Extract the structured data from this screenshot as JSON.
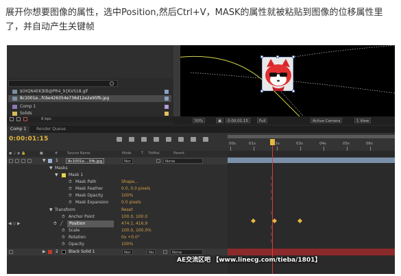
{
  "caption": "展开你想要图像的属性，选中Position,然后Ctrl+V，MASK的属性就被粘贴到图像的位移属性里了，并自动产生关键帧",
  "project": {
    "items": [
      {
        "name": "$(HQN4EK]KB@PR4_9{KVS18.gif",
        "type": "image",
        "selected": false
      },
      {
        "name": "8c1001e...fcbe426354e736d12e2e95fb.jpg",
        "type": "image",
        "selected": true
      },
      {
        "name": "Comp 1",
        "type": "comp",
        "selected": false
      },
      {
        "name": "Solids",
        "type": "folder",
        "selected": false
      }
    ],
    "bpc": "8 bpc"
  },
  "viewer": {
    "zoom": "50%",
    "timecode": "0:00:01:15",
    "resolution": "Full",
    "camera": "Active Camera",
    "view": "1 View"
  },
  "timeline": {
    "tabs": [
      "Comp 1",
      "Render Queue"
    ],
    "timecode": "0:00:01:15",
    "columns": {
      "source_name": "Source Name",
      "mode": "Mode",
      "t": "T",
      "trkmat": "TrkMat",
      "parent": "Parent"
    },
    "ruler": [
      "00s",
      "01s",
      "02s",
      "03s",
      "04s",
      "05s",
      "06s"
    ],
    "layers": [
      {
        "kind": "layer",
        "num": "1",
        "name": "8c1001e....5fb.jpg",
        "mode": "Nor",
        "parent": "None",
        "label_color": "#9fb3d6"
      },
      {
        "kind": "group",
        "label": "Masks"
      },
      {
        "kind": "group2",
        "label": "Mask 1",
        "label_color": "#e6d24a"
      },
      {
        "kind": "prop",
        "label": "Mask Path",
        "value": "Shape..."
      },
      {
        "kind": "prop",
        "label": "Mask Feather",
        "value": "0.0, 0.0 pixels"
      },
      {
        "kind": "prop",
        "label": "Mask Opacity",
        "value": "100%"
      },
      {
        "kind": "prop",
        "label": "Mask Expansion",
        "value": "0.0 pixels"
      },
      {
        "kind": "group",
        "label": "Transform",
        "value": "Reset"
      },
      {
        "kind": "prop",
        "label": "Anchor Point",
        "value": "100.0, 100.0"
      },
      {
        "kind": "prop",
        "label": "Position",
        "value": "474.1, 416.9",
        "highlight": true
      },
      {
        "kind": "prop",
        "label": "Scale",
        "value": "100.0, 100.0%"
      },
      {
        "kind": "prop",
        "label": "Rotation",
        "value": "0x +0.0°"
      },
      {
        "kind": "prop",
        "label": "Opacity",
        "value": "100%"
      },
      {
        "kind": "layer",
        "num": "2",
        "name": "Black Solid 1",
        "mode": "Nor",
        "trkmat": "No",
        "parent": "None",
        "label_color": "#c0392b"
      }
    ]
  },
  "watermark": "AE交流区吧 【www.linecg.com/tieba/1801】",
  "colors": {
    "timecode": "#e6b83e",
    "value": "#d6a24a",
    "cti": "#e03a3a",
    "keyframe": "#e6b83e"
  }
}
